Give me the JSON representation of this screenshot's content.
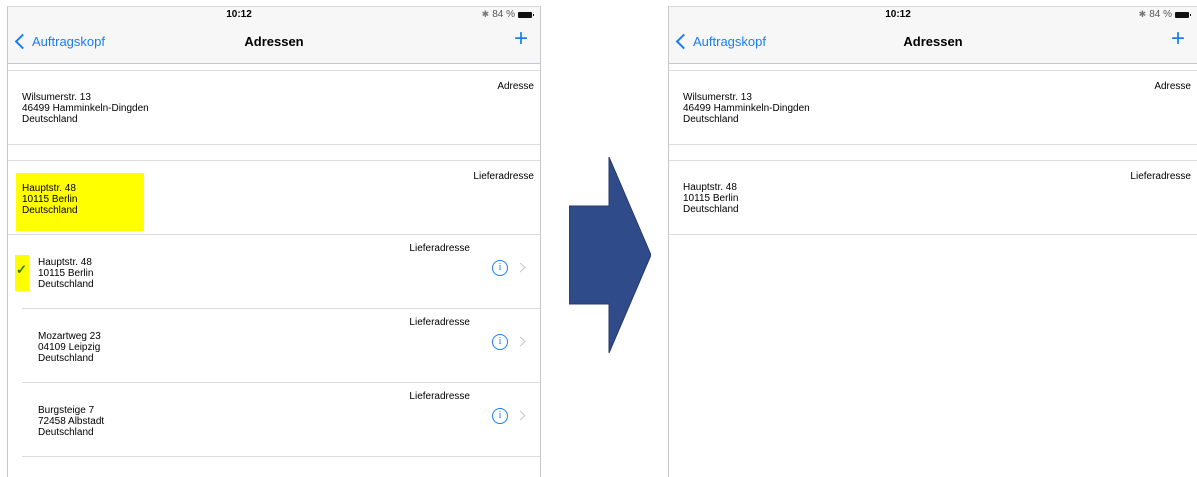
{
  "status": {
    "time": "10:12",
    "battery": "84 %"
  },
  "nav": {
    "back_label": "Auftragskopf",
    "title": "Adressen",
    "add": "+"
  },
  "left": {
    "address1": {
      "type": "Adresse",
      "lines": [
        "Wilsumerstr. 13",
        "46499 Hamminkeln-Dingden",
        "Deutschland"
      ]
    },
    "address2": {
      "type": "Lieferadresse",
      "lines": [
        "Hauptstr. 48",
        "10115 Berlin",
        "Deutschland"
      ]
    },
    "options": [
      {
        "type": "Lieferadresse",
        "lines": [
          "Hauptstr. 48",
          "10115 Berlin",
          "Deutschland"
        ],
        "selected": true
      },
      {
        "type": "Lieferadresse",
        "lines": [
          "Mozartweg 23",
          "04109 Leipzig",
          "Deutschland"
        ],
        "selected": false
      },
      {
        "type": "Lieferadresse",
        "lines": [
          "Burgsteige 7",
          "72458 Albstadt",
          "Deutschland"
        ],
        "selected": false
      }
    ]
  },
  "right": {
    "address1": {
      "type": "Adresse",
      "lines": [
        "Wilsumerstr. 13",
        "46499 Hamminkeln-Dingden",
        "Deutschland"
      ]
    },
    "address2": {
      "type": "Lieferadresse",
      "lines": [
        "Hauptstr. 48",
        "10115 Berlin",
        "Deutschland"
      ]
    }
  },
  "colors": {
    "accent": "#1a7cf5",
    "highlight": "#ffff00",
    "arrow": "#2f4b8a",
    "check": "#2a7d10"
  }
}
